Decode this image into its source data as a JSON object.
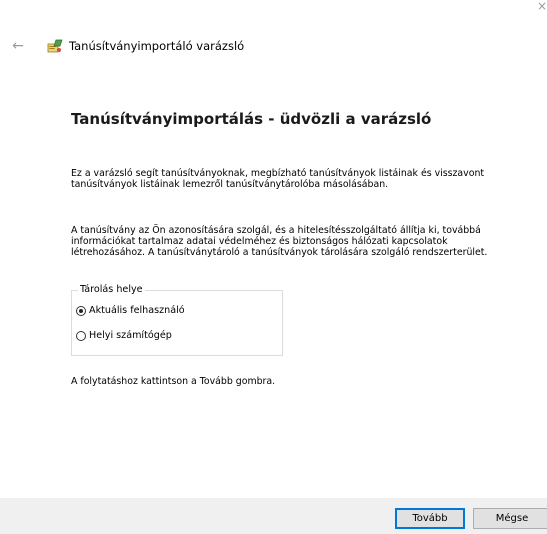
{
  "window": {
    "title": "Tanúsítványimportáló varázsló",
    "close_icon": "×",
    "back_icon": "←"
  },
  "content": {
    "heading": "Tanúsítványimportálás - üdvözli a varázsló",
    "para1_line1": "Ez a varázsló segít tanúsítványoknak, megbízható tanúsítványok listáinak és visszavont",
    "para1_line2": "tanúsítványok listáinak lemezről tanúsítványtárolóba másolásában.",
    "para2_line1": "A tanúsítvány az Ön azonosítására szolgál, és a hitelesítésszolgáltató állítja ki, továbbá",
    "para2_line2": "információkat tartalmaz adatai védelméhez és biztonságos hálózati kapcsolatok",
    "para2_line3": "létrehozásához. A tanúsítványtároló a tanúsítványok tárolására szolgáló rendszerterület.",
    "store_location": {
      "legend": "Tárolás helye",
      "options": [
        {
          "label": "Aktuális felhasználó",
          "selected": true
        },
        {
          "label": "Helyi számítógép",
          "selected": false
        }
      ]
    },
    "footnote": "A folytatáshoz kattintson a Tovább gombra."
  },
  "footer": {
    "next_label": "Tovább",
    "cancel_label": "Mégse"
  }
}
